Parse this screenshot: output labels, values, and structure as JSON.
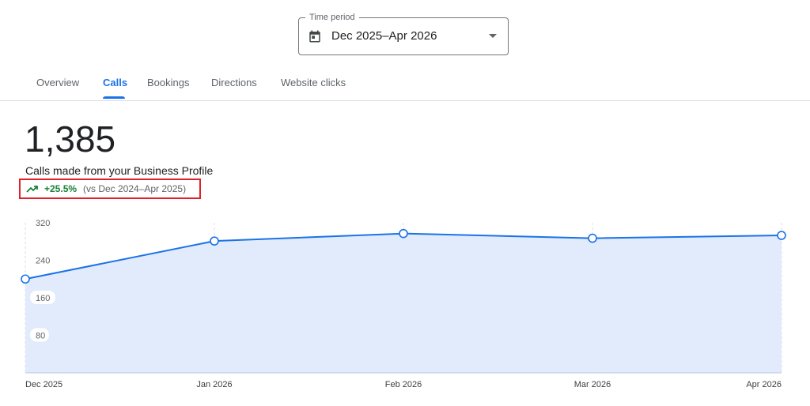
{
  "time_period": {
    "legend": "Time period",
    "value": "Dec 2025–Apr 2026",
    "icon": "calendar-icon"
  },
  "tabs": [
    {
      "label": "Overview",
      "active": false
    },
    {
      "label": "Calls",
      "active": true
    },
    {
      "label": "Bookings",
      "active": false
    },
    {
      "label": "Directions",
      "active": false
    },
    {
      "label": "Website clicks",
      "active": false
    }
  ],
  "metric": {
    "value": "1,385",
    "label": "Calls made from your Business Profile",
    "change": "+25.5%",
    "comparison": "(vs Dec 2024–Apr 2025)",
    "trend_icon": "trending-up-icon"
  },
  "colors": {
    "accent": "#1a73e8",
    "positive": "#188038",
    "highlight_box": "#e2202a",
    "area_fill": "#e2ebfb"
  },
  "chart_data": {
    "type": "area",
    "x": [
      "Dec 2025",
      "Jan 2026",
      "Feb 2026",
      "Mar 2026",
      "Apr 2026"
    ],
    "values": [
      200,
      281,
      297,
      287,
      293
    ],
    "yticks": [
      80,
      160,
      240,
      320
    ],
    "ylim": [
      0,
      320
    ],
    "grid": "vertical dashed",
    "title": "",
    "xlabel": "",
    "ylabel": ""
  }
}
